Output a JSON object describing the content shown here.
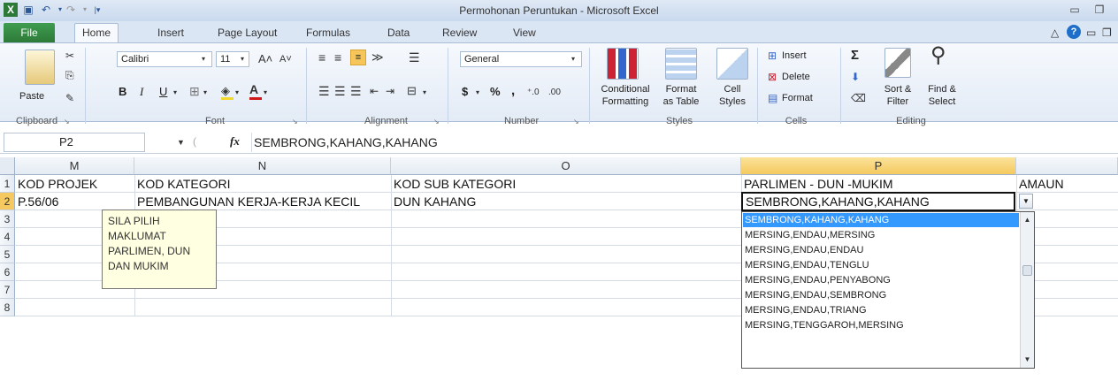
{
  "window": {
    "title": "Permohonan Peruntukan  -  Microsoft Excel"
  },
  "tabs": [
    "File",
    "Home",
    "Insert",
    "Page Layout",
    "Formulas",
    "Data",
    "Review",
    "View"
  ],
  "ribbon": {
    "clipboard": {
      "paste": "Paste",
      "label": "Clipboard"
    },
    "font": {
      "name": "Calibri",
      "size": "11",
      "label": "Font",
      "bold": "B",
      "italic": "I",
      "underline": "U"
    },
    "alignment": {
      "label": "Alignment"
    },
    "number": {
      "format": "General",
      "currency": "$",
      "percent": "%",
      "comma": ",",
      "label": "Number"
    },
    "styles": {
      "conditional": "Conditional",
      "conditional2": "Formatting",
      "format_table": "Format",
      "format_table2": "as Table",
      "cell_styles": "Cell",
      "cell_styles2": "Styles",
      "label": "Styles"
    },
    "cells": {
      "insert": "Insert",
      "delete": "Delete",
      "format": "Format",
      "label": "Cells"
    },
    "editing": {
      "sum": "Σ",
      "sort": "Sort &",
      "sort2": "Filter",
      "find": "Find &",
      "find2": "Select",
      "label": "Editing"
    }
  },
  "formula_bar": {
    "name_box": "P2",
    "fx": "fx",
    "value": "SEMBRONG,KAHANG,KAHANG"
  },
  "grid": {
    "columns": [
      "M",
      "N",
      "O",
      "P",
      ""
    ],
    "rows": [
      "1",
      "2",
      "3",
      "4",
      "5",
      "6",
      "7",
      "8"
    ],
    "row1": [
      "KOD PROJEK",
      "KOD  KATEGORI",
      "KOD SUB KATEGORI",
      "PARLIMEN - DUN -MUKIM",
      "AMAUN"
    ],
    "row2": [
      "P.56/06",
      "PEMBANGUNAN KERJA-KERJA KECIL",
      "DUN KAHANG",
      "SEMBRONG,KAHANG,KAHANG"
    ]
  },
  "tooltip": {
    "lines": [
      "SILA PILIH",
      "MAKLUMAT",
      "PARLIMEN, DUN",
      "DAN MUKIM"
    ]
  },
  "dropdown": {
    "options": [
      "SEMBRONG,KAHANG,KAHANG",
      "MERSING,ENDAU,MERSING",
      "MERSING,ENDAU,ENDAU",
      "MERSING,ENDAU,TENGLU",
      "MERSING,ENDAU,PENYABONG",
      "MERSING,ENDAU,SEMBRONG",
      "MERSING,ENDAU,TRIANG",
      "MERSING,TENGGAROH,MERSING"
    ],
    "selected_index": 0
  },
  "colors": {
    "accent": "#217346",
    "selection": "#3399ff",
    "header_selected": "#f5c95f"
  }
}
